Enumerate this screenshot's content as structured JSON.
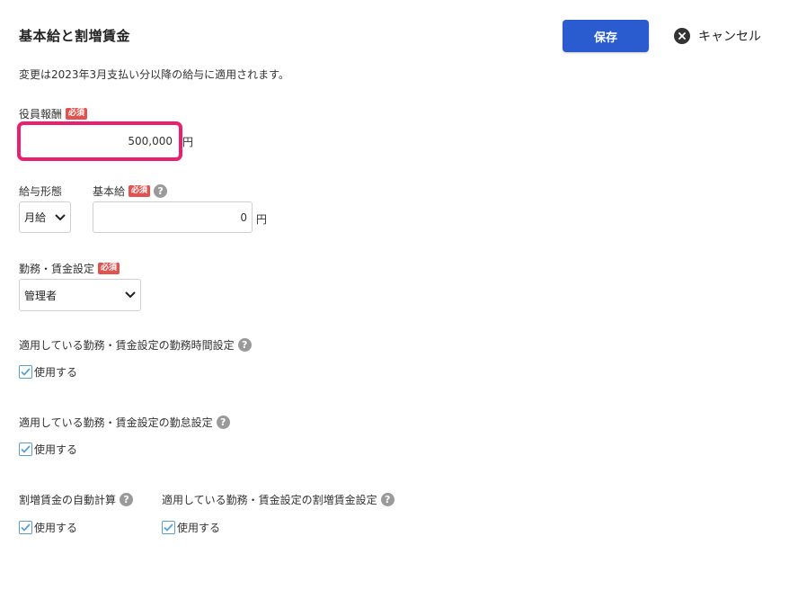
{
  "header": {
    "title": "基本給と割増賃金",
    "save_label": "保存",
    "cancel_label": "キャンセル"
  },
  "notice": "変更は2023年3月支払い分以降の給与に適用されます。",
  "required_badge": "必須",
  "help_glyph": "?",
  "executive_pay": {
    "label": "役員報酬",
    "value": "500,000",
    "unit": "円"
  },
  "pay_type": {
    "label": "給与形態",
    "selected": "月給"
  },
  "base_salary": {
    "label": "基本給",
    "value": "0",
    "unit": "円"
  },
  "work_setting": {
    "label": "勤務・賃金設定",
    "selected": "管理者"
  },
  "work_hours_setting": {
    "label": "適用している勤務・賃金設定の勤務時間設定",
    "checkbox_label": "使用する",
    "checked": true
  },
  "attendance_setting": {
    "label": "適用している勤務・賃金設定の勤怠設定",
    "checkbox_label": "使用する",
    "checked": true
  },
  "auto_calc": {
    "label": "割増賃金の自動計算",
    "checkbox_label": "使用する",
    "checked": true
  },
  "premium_setting": {
    "label": "適用している勤務・賃金設定の割増賃金設定",
    "checkbox_label": "使用する",
    "checked": true
  },
  "colors": {
    "primary": "#2a5ccf",
    "highlight": "#ea1f6e",
    "required": "#e2534f",
    "checkbox": "#5a9fd4"
  }
}
